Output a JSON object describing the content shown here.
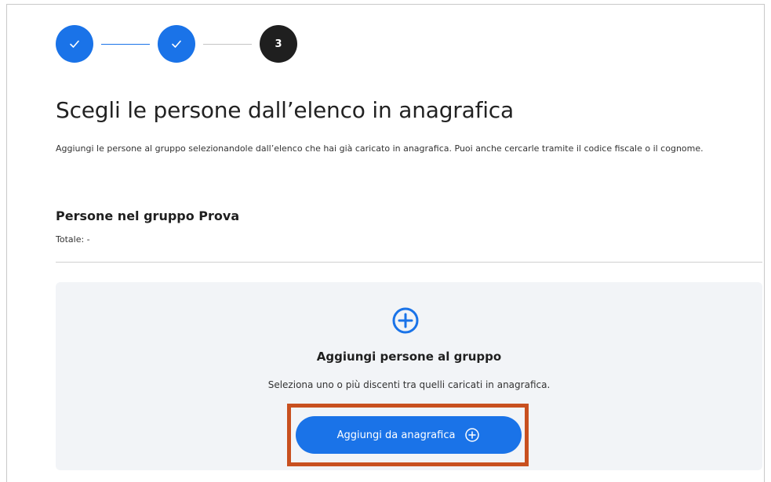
{
  "stepper": {
    "steps": [
      {
        "state": "completed",
        "icon": "check-icon"
      },
      {
        "state": "completed",
        "icon": "check-icon"
      },
      {
        "state": "current",
        "label": "3"
      }
    ],
    "colors": {
      "completed": "#1a73e8",
      "current": "#1f1f1f",
      "pending_line": "#c4c4c4"
    }
  },
  "page": {
    "title": "Scegli le persone dall’elenco in anagrafica",
    "description": "Aggiungi le persone al gruppo selezionandole dall’elenco che hai già caricato in anagrafica. Puoi anche cercarle tramite il codice fiscale o il cognome."
  },
  "group": {
    "title": "Persone nel gruppo Prova",
    "total": "Totale: -"
  },
  "empty_state": {
    "icon": "plus-circle-icon",
    "title": "Aggiungi persone al gruppo",
    "subtitle": "Seleziona uno o più discenti tra quelli caricati in anagrafica.",
    "button_label": "Aggiungi da anagrafica",
    "button_icon": "plus-circle-icon"
  },
  "colors": {
    "accent": "#1a73e8",
    "highlight_border": "#c8501f",
    "card_background": "#f2f4f7"
  }
}
